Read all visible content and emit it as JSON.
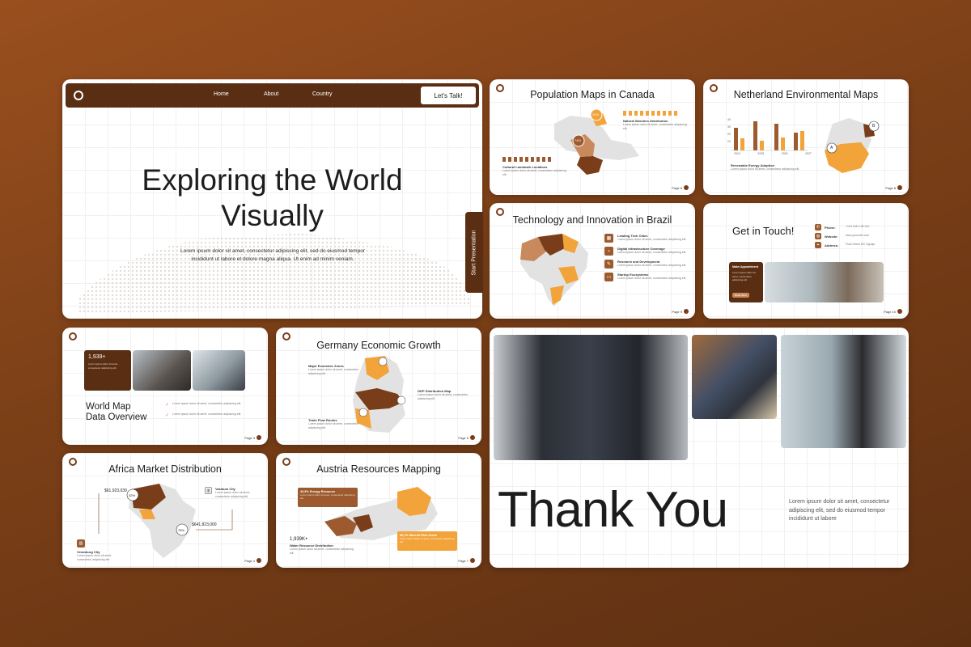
{
  "main_slide": {
    "nav": [
      "Home",
      "About",
      "Country"
    ],
    "cta": "Let's Talk!",
    "title_line1": "Exploring the World",
    "title_line2": "Visually",
    "body": "Lorem ipsum dolor sit amet, consectetur adipiscing elit, sed do eiusmod tempor incididunt ut labore et dolore magna aliqua. Ut enim ad minim veniam.",
    "side_tab": "Start Presentation"
  },
  "canada": {
    "title": "Population Maps in Canada",
    "label1": "Natural Wonders Distribution",
    "label2": "Cultural Landmark Locations",
    "pct1": "26%",
    "pct2": "74%",
    "page": "Page 6"
  },
  "netherland": {
    "title": "Netherland Environmental Maps",
    "label": "Renewable Energy Adoption",
    "marker_a": "A",
    "marker_b": "B",
    "years": [
      "2024",
      "2025",
      "2026",
      "2027"
    ],
    "y_ticks": [
      "40",
      "30",
      "20",
      "10"
    ],
    "page": "Page 8"
  },
  "brazil": {
    "title": "Technology and Innovation in Brazil",
    "items": [
      "Leading Tech Cities",
      "Digital Infrastructure Coverage",
      "Research and Development",
      "Startup Ecosystems"
    ],
    "page": "Page 9"
  },
  "contact": {
    "title": "Get in Touch!",
    "fields": [
      {
        "label": "Phone:",
        "value": "+123 945 4 68 910"
      },
      {
        "label": "Website:",
        "value": "www.yourweb.com"
      },
      {
        "label": "Address:",
        "value": "Fluid Street 6/C Ngoajo"
      }
    ],
    "card_title": "Make Appointment",
    "card_button": "Read More",
    "page": "Page 10"
  },
  "world": {
    "stat": "1,939+",
    "title_line1": "World Map",
    "title_line2": "Data Overview",
    "page": "Page 3"
  },
  "germany": {
    "title": "Germany Economic Growth",
    "label1": "Major Economic Zones",
    "label2": "GDP Distribution Map",
    "label3": "Trade Flow Routes",
    "page": "Page 5"
  },
  "africa": {
    "title": "Africa Market Distribution",
    "value1": "$61,923,039",
    "value2": "$641,823,000",
    "pct1": "32%",
    "pct2": "78%",
    "city1": "Vaslaum City",
    "city2": "Veranburg City",
    "page": "Page 4"
  },
  "austria": {
    "title": "Austria Resources Mapping",
    "box1": "43,5% Energy Resource",
    "box2": "56,1% Mineral Rich Areas",
    "stat": "1,939K+",
    "stat_label": "Water Resource Distribution",
    "page": "Page 7"
  },
  "thankyou": {
    "title": "Thank You",
    "body": "Lorem ipsum dolor sit amet, consectetur adipiscing elit, sed do eiusmod tempor incididunt ut labore"
  },
  "lorem_short": "Lorem ipsum dolor sit amet, consectetur adipiscing elit.",
  "colors": {
    "accent": "#7a3d1a",
    "orange": "#f2a33a",
    "tan": "#c88a5c",
    "dark": "#5a2e12"
  }
}
